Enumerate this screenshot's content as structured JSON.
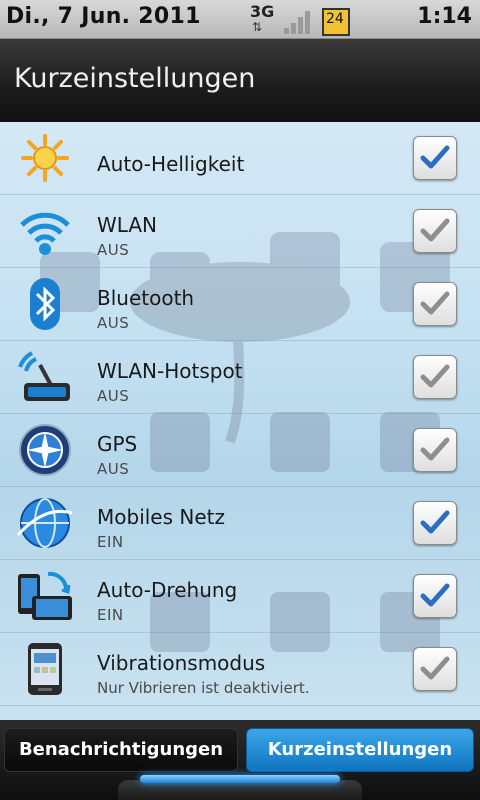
{
  "status": {
    "date": "Di., 7 Jun. 2011",
    "network": "3G",
    "battery_level": "24",
    "time": "1:14"
  },
  "header": {
    "title": "Kurzeinstellungen"
  },
  "items": [
    {
      "label": "Auto-Helligkeit",
      "sub": "",
      "checked": true,
      "check_color": "#2b6fc4",
      "icon": "brightness-icon"
    },
    {
      "label": "WLAN",
      "sub": "AUS",
      "checked": true,
      "check_color": "#8e8e8e",
      "icon": "wifi-icon"
    },
    {
      "label": "Bluetooth",
      "sub": "AUS",
      "checked": true,
      "check_color": "#8e8e8e",
      "icon": "bluetooth-icon"
    },
    {
      "label": "WLAN-Hotspot",
      "sub": "AUS",
      "checked": true,
      "check_color": "#8e8e8e",
      "icon": "hotspot-icon"
    },
    {
      "label": "GPS",
      "sub": "AUS",
      "checked": true,
      "check_color": "#8e8e8e",
      "icon": "gps-icon"
    },
    {
      "label": "Mobiles Netz",
      "sub": "EIN",
      "checked": true,
      "check_color": "#2b6fc4",
      "icon": "mobile-network-icon"
    },
    {
      "label": "Auto-Drehung",
      "sub": "EIN",
      "checked": true,
      "check_color": "#2b6fc4",
      "icon": "rotation-icon"
    },
    {
      "label": "Vibrationsmodus",
      "sub": "Nur Vibrieren ist deaktiviert.",
      "checked": true,
      "check_color": "#8e8e8e",
      "icon": "vibration-phone-icon"
    }
  ],
  "tabs": {
    "notifications": "Benachrichtigungen",
    "quick_settings": "Kurzeinstellungen"
  },
  "colors": {
    "accent": "#1a84d4",
    "list_bg": "#c4e1f2"
  }
}
